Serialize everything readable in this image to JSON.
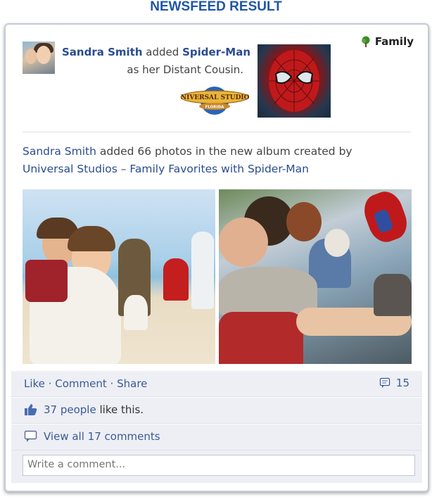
{
  "header": {
    "title": "NEWSFEED RESULT"
  },
  "story": {
    "actor": "Sandra Smith",
    "verb": "added",
    "target": "Spider-Man",
    "relation": "as her Distant Cousin.",
    "audience": "Family"
  },
  "post": {
    "actor": "Sandra Smith",
    "text_middle": "added 66 photos in the new album created by",
    "album": "Universal Studios – Family Favorites with Spider-Man"
  },
  "logo": {
    "line1": "UNIVERSAL STUDIOS",
    "line2": "FLORIDA"
  },
  "actions": {
    "like": "Like",
    "sep1": "·",
    "comment": "Comment",
    "sep2": "·",
    "share": "Share",
    "comment_count": "15"
  },
  "likes": {
    "people": "37 people",
    "suffix": "like this."
  },
  "comments": {
    "view_all": "View all 17 comments"
  },
  "composer": {
    "placeholder": "Write a comment..."
  },
  "colors": {
    "link": "#3b5998",
    "header": "#1f56a6",
    "bar_bg": "#edeff4"
  }
}
